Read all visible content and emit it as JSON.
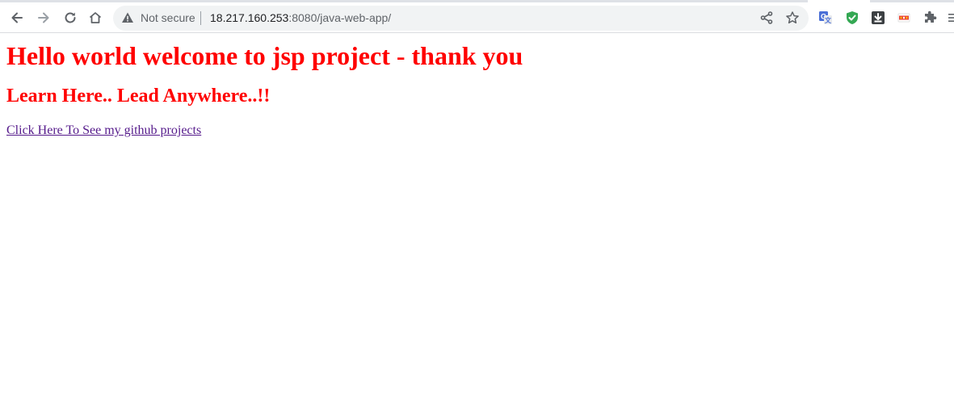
{
  "browser": {
    "security_label": "Not secure",
    "url_host": "18.217.160.253",
    "url_path": ":8080/java-web-app/"
  },
  "toolbar_icons": [
    "back-arrow-icon",
    "forward-arrow-icon",
    "reload-icon",
    "home-icon",
    "warning-icon",
    "share-icon",
    "star-icon",
    "translate-icon",
    "shield-check-icon",
    "download-icon",
    "extension-badge-icon",
    "puzzle-icon",
    "menu-icon"
  ],
  "page": {
    "heading": "Hello world welcome to jsp project - thank you",
    "subheading": "Learn Here.. Lead Anywhere..!!",
    "link_text": "Click Here To See my github projects"
  },
  "colors": {
    "heading": "#ff0000",
    "link_visited": "#551a8b",
    "omnibox_bg": "#f1f3f4"
  }
}
